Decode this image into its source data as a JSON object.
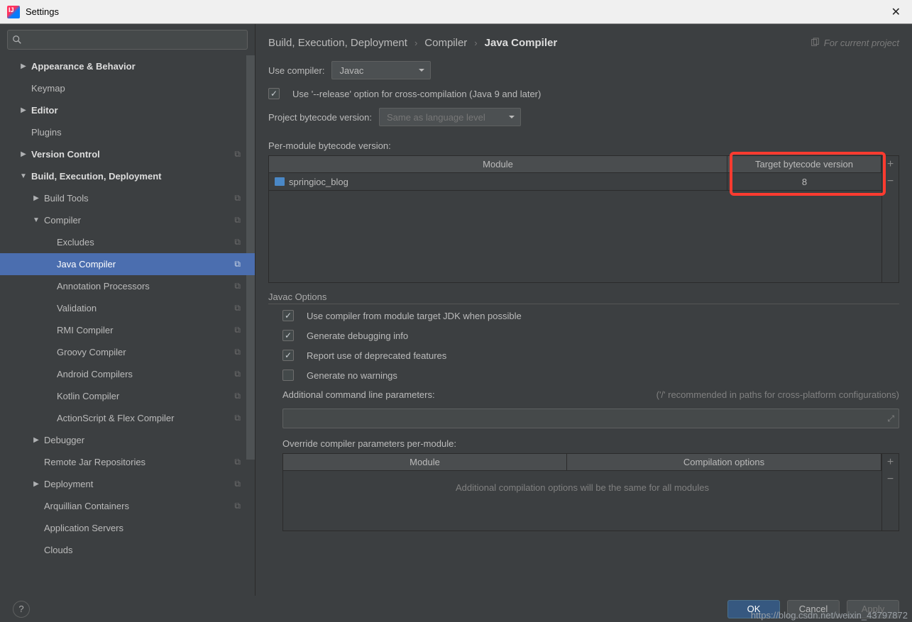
{
  "window": {
    "title": "Settings"
  },
  "breadcrumb": {
    "a": "Build, Execution, Deployment",
    "b": "Compiler",
    "c": "Java Compiler",
    "project_hint": "For current project"
  },
  "sidebar": [
    {
      "label": "Appearance & Behavior",
      "bold": true,
      "chev": "▶",
      "lvl": 1
    },
    {
      "label": "Keymap",
      "lvl": 1
    },
    {
      "label": "Editor",
      "bold": true,
      "chev": "▶",
      "lvl": 1
    },
    {
      "label": "Plugins",
      "lvl": 1
    },
    {
      "label": "Version Control",
      "bold": true,
      "chev": "▶",
      "lvl": 1,
      "proj": true
    },
    {
      "label": "Build, Execution, Deployment",
      "bold": true,
      "chev": "▼",
      "lvl": 1
    },
    {
      "label": "Build Tools",
      "chev": "▶",
      "lvl": 2,
      "proj": true
    },
    {
      "label": "Compiler",
      "chev": "▼",
      "lvl": 2,
      "proj": true
    },
    {
      "label": "Excludes",
      "lvl": 3,
      "proj": true
    },
    {
      "label": "Java Compiler",
      "lvl": 3,
      "proj": true,
      "selected": true
    },
    {
      "label": "Annotation Processors",
      "lvl": 3,
      "proj": true
    },
    {
      "label": "Validation",
      "lvl": 3,
      "proj": true
    },
    {
      "label": "RMI Compiler",
      "lvl": 3,
      "proj": true
    },
    {
      "label": "Groovy Compiler",
      "lvl": 3,
      "proj": true
    },
    {
      "label": "Android Compilers",
      "lvl": 3,
      "proj": true
    },
    {
      "label": "Kotlin Compiler",
      "lvl": 3,
      "proj": true
    },
    {
      "label": "ActionScript & Flex Compiler",
      "lvl": 3,
      "proj": true
    },
    {
      "label": "Debugger",
      "chev": "▶",
      "lvl": 2
    },
    {
      "label": "Remote Jar Repositories",
      "lvl": 2,
      "proj": true
    },
    {
      "label": "Deployment",
      "chev": "▶",
      "lvl": 2,
      "proj": true
    },
    {
      "label": "Arquillian Containers",
      "lvl": 2,
      "proj": true
    },
    {
      "label": "Application Servers",
      "lvl": 2
    },
    {
      "label": "Clouds",
      "lvl": 2
    }
  ],
  "form": {
    "use_compiler_label": "Use compiler:",
    "use_compiler_value": "Javac",
    "release_opt": "Use '--release' option for cross-compilation (Java 9 and later)",
    "proj_bytecode_label": "Project bytecode version:",
    "proj_bytecode_value": "Same as language level",
    "per_module_label": "Per-module bytecode version:",
    "table1": {
      "col_module": "Module",
      "col_target": "Target bytecode version",
      "rows": [
        {
          "module": "springioc_blog",
          "target": "8"
        }
      ]
    },
    "javac_section": "Javac Options",
    "opt_use_module_jdk": "Use compiler from module target JDK when possible",
    "opt_debug": "Generate debugging info",
    "opt_deprecated": "Report use of deprecated features",
    "opt_nowarn": "Generate no warnings",
    "add_cmd_label": "Additional command line parameters:",
    "add_cmd_hint": "('/' recommended in paths for cross-platform configurations)",
    "override_label": "Override compiler parameters per-module:",
    "table2": {
      "col_module": "Module",
      "col_opts": "Compilation options",
      "empty": "Additional compilation options will be the same for all modules"
    }
  },
  "footer": {
    "ok": "OK",
    "cancel": "Cancel",
    "apply": "Apply"
  },
  "watermark": "https://blog.csdn.net/weixin_43797872"
}
